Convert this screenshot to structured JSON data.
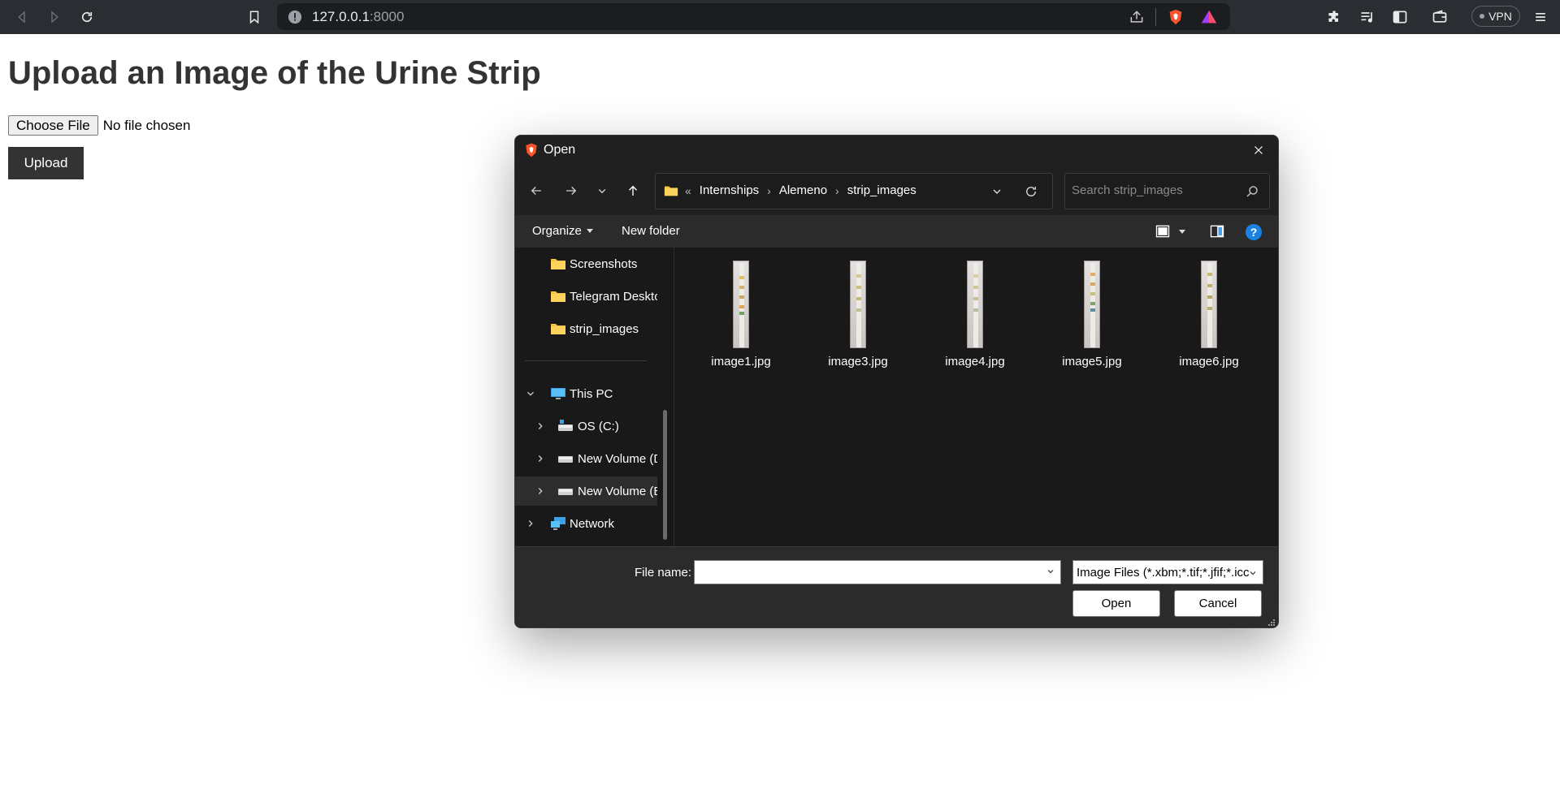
{
  "browser": {
    "url_host": "127.0.0.1",
    "url_port": ":8000",
    "vpn_label": "VPN"
  },
  "page": {
    "title": "Upload an Image of the Urine Strip",
    "choose_file_label": "Choose File",
    "no_file_text": "No file chosen",
    "upload_label": "Upload"
  },
  "dialog": {
    "title": "Open",
    "breadcrumb": [
      "Internships",
      "Alemeno",
      "strip_images"
    ],
    "breadcrumb_prefix": "«",
    "search_placeholder": "Search strip_images",
    "commands": {
      "organize": "Organize",
      "new_folder": "New folder"
    },
    "nav_pane": {
      "quick_items": [
        {
          "label": "Screenshots"
        },
        {
          "label": "Telegram Desktop"
        },
        {
          "label": "strip_images"
        }
      ],
      "this_pc": "This PC",
      "drives": [
        {
          "label": "OS (C:)"
        },
        {
          "label": "New Volume (D:)"
        },
        {
          "label": "New Volume (E:)"
        }
      ],
      "network": "Network"
    },
    "files": [
      {
        "name": "image1.jpg"
      },
      {
        "name": "image3.jpg"
      },
      {
        "name": "image4.jpg"
      },
      {
        "name": "image5.jpg"
      },
      {
        "name": "image6.jpg"
      }
    ],
    "file_name_label": "File name:",
    "file_name_value": "",
    "filter_value": "Image Files (*.xbm;*.tif;*.jfif;*.icc",
    "open_label": "Open",
    "cancel_label": "Cancel"
  }
}
